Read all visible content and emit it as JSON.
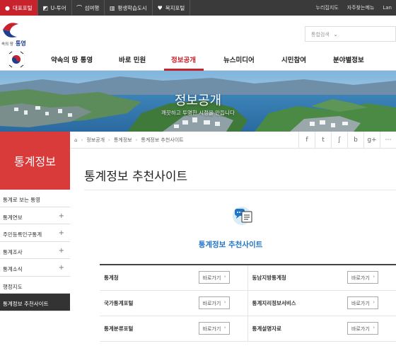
{
  "topbar": {
    "links": [
      {
        "label": "대표포털",
        "icon": "gov-icon"
      },
      {
        "label": "U-투어",
        "icon": "tour-icon"
      },
      {
        "label": "섬여행",
        "icon": "island-icon"
      },
      {
        "label": "평생학습도시",
        "icon": "book-icon"
      },
      {
        "label": "복지포털",
        "icon": "heart-icon"
      }
    ],
    "right_links": [
      "누리집지도",
      "자주찾는메뉴",
      "Lan"
    ]
  },
  "header": {
    "logo_text": "통영",
    "search_placeholder": "통합검색"
  },
  "nav": {
    "items": [
      "약속의 땅 통영",
      "바로 민원",
      "정보공개",
      "뉴스미디어",
      "시민참여",
      "분야별정보"
    ],
    "active": "정보공개"
  },
  "banner": {
    "title": "정보공개",
    "subtitle": "깨끗하고 투명한 시정을 만듭니다"
  },
  "sidebar": {
    "title": "통계정보",
    "items": [
      {
        "label": "통계로 보는 통영",
        "plus": false
      },
      {
        "label": "통계연보",
        "plus": true
      },
      {
        "label": "주민등록인구통계",
        "plus": true
      },
      {
        "label": "통계조사",
        "plus": true
      },
      {
        "label": "통계소식",
        "plus": true
      },
      {
        "label": "행정지도",
        "plus": false
      },
      {
        "label": "통계정보 추천사이트",
        "plus": false
      }
    ],
    "active": "통계정보 추천사이트"
  },
  "breadcrumb": [
    "정보공개",
    "통계정보",
    "통계정보 추천사이트"
  ],
  "share_icons": [
    "facebook-icon",
    "twitter-icon",
    "kakao-story-icon",
    "blog-icon",
    "google-plus-icon",
    "more-icon"
  ],
  "share_glyphs": [
    "f",
    "t",
    "ʃ",
    "b",
    "g+",
    "⋯"
  ],
  "page_title": "통계정보 추천사이트",
  "card": {
    "title": "통계정보 추천사이트",
    "go_label": "바로가기",
    "rows": [
      [
        "통계청",
        "동남지방통계청"
      ],
      [
        "국가통계포털",
        "통계지리정보서비스"
      ],
      [
        "통계분류포털",
        "통계설명자료"
      ]
    ]
  },
  "colors": {
    "accent": "#c8232c",
    "sidebar_head": "#d93a3a",
    "link_blue": "#1f74c9",
    "topbar": "#3a3a3a"
  }
}
